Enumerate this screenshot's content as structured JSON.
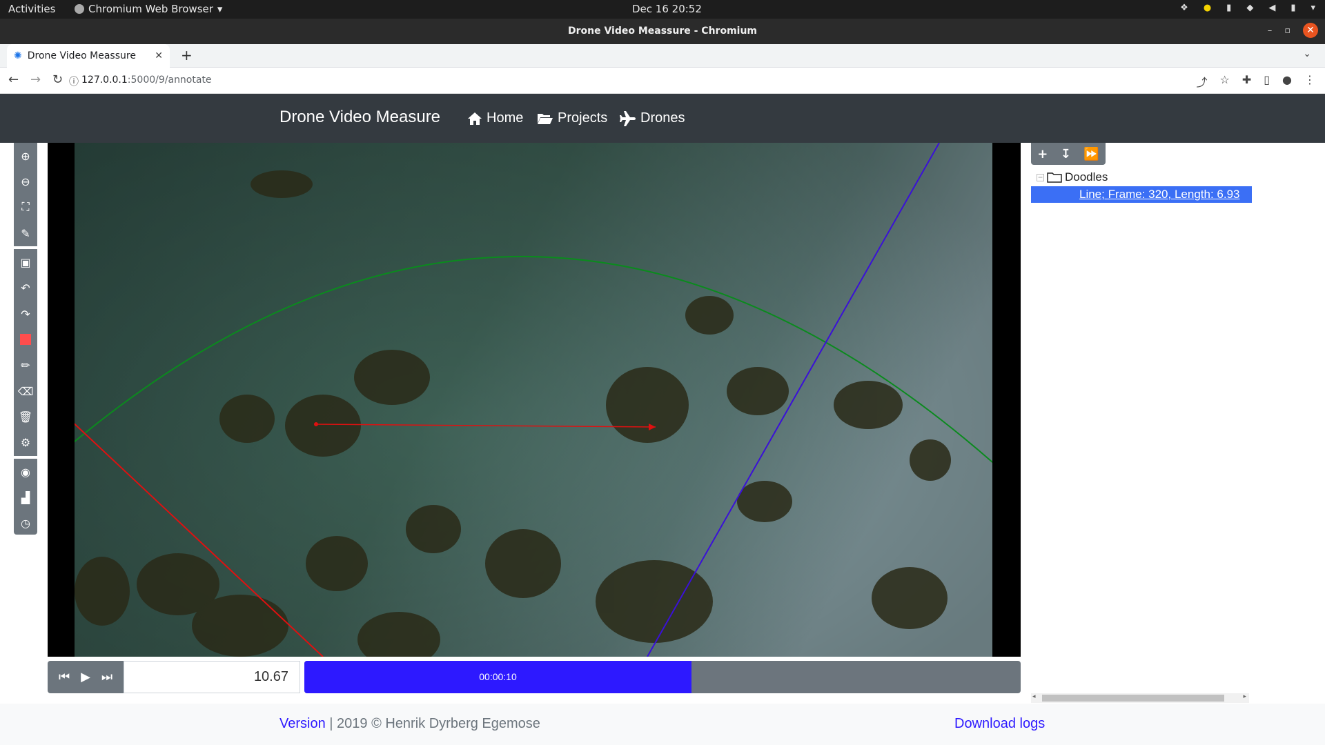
{
  "os": {
    "activities": "Activities",
    "app_menu": "Chromium Web Browser",
    "clock": "Dec 16  20:52"
  },
  "window": {
    "title": "Drone Video Meassure - Chromium"
  },
  "browser": {
    "tab_title": "Drone Video Meassure",
    "url_host": "127.0.0.1",
    "url_path": ":5000/9/annotate"
  },
  "navbar": {
    "brand": "Drone Video Measure",
    "links": [
      {
        "label": "Home",
        "icon": "home-icon"
      },
      {
        "label": "Projects",
        "icon": "folder-open-icon"
      },
      {
        "label": "Drones",
        "icon": "plane-icon"
      }
    ]
  },
  "toolbar": {
    "buttons": [
      "zoom-in-icon",
      "zoom-out-icon",
      "fit-screen-icon",
      "edit-icon",
      "save-icon",
      "undo-icon",
      "redo-icon",
      "color-swatch-icon",
      "pencil-icon",
      "eraser-icon",
      "trash-icon",
      "settings-icon",
      "compass-icon",
      "chart-icon",
      "clock-icon"
    ],
    "accent_color": "#ff4d4d"
  },
  "player": {
    "frame_value": "10.67",
    "time_label": "00:00:10",
    "progress_fraction": 0.54
  },
  "tree": {
    "folder": "Doodles",
    "item": "Line; Frame: 320, Length: 6.93"
  },
  "footer": {
    "version_link": "Version",
    "copyright": " | 2019 © Henrik Dyrberg Egemose",
    "download_link": "Download logs"
  },
  "colors": {
    "navbar_bg": "#343a40",
    "progress_fill": "#2d19ff",
    "tree_select": "#3b6ff5",
    "line_red": "#e01010",
    "line_green": "#0b8a1e",
    "line_blue": "#3a10d8"
  }
}
